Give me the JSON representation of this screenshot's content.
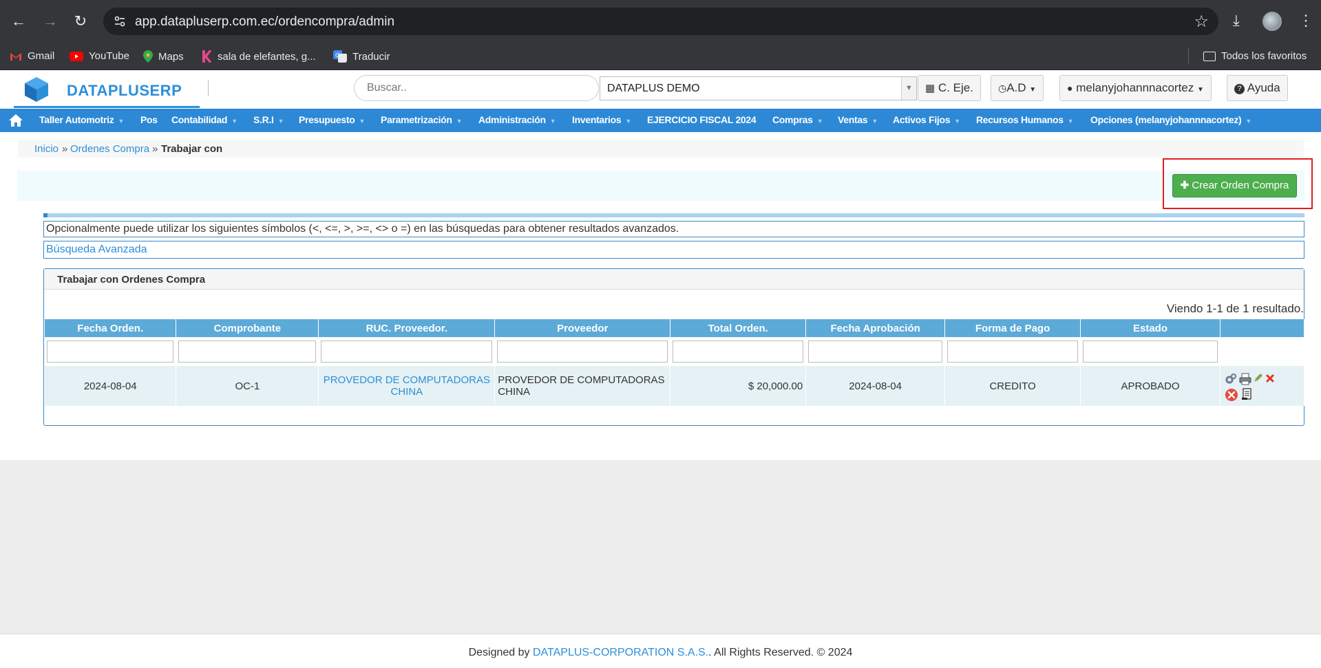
{
  "browser": {
    "url": "app.datapluserp.com.ec/ordencompra/admin",
    "bookmarks": [
      {
        "label": "Gmail"
      },
      {
        "label": "YouTube"
      },
      {
        "label": "Maps"
      },
      {
        "label": "sala de elefantes, g..."
      },
      {
        "label": "Traducir"
      }
    ],
    "all_bookmarks": "Todos los favoritos"
  },
  "header": {
    "logo_text": "DATAPLUSERP",
    "search_placeholder": "Buscar..",
    "company": "DATAPLUS DEMO",
    "btn_exercise": "C. Eje.",
    "btn_ad": "A.D",
    "btn_user": "melanyjohannnacortez",
    "btn_help": "Ayuda"
  },
  "menu": [
    "Taller Automotriz",
    "Pos",
    "Contabilidad",
    "S.R.I",
    "Presupuesto",
    "Parametrización",
    "Administración",
    "Inventarios",
    "EJERCICIO FISCAL 2024",
    "Compras",
    "Ventas",
    "Activos Fijos",
    "Recursos Humanos",
    "Opciones (melanyjohannnacortez)"
  ],
  "breadcrumb": {
    "home": "Inicio",
    "section": "Ordenes Compra",
    "current": "Trabajar con",
    "sep": "»"
  },
  "create_button": "Crear Orden Compra",
  "info_text": "Opcionalmente puede utilizar los siguientes símbolos (<, <=, >, >=, <> o =) en las búsquedas para obtener resultados avanzados.",
  "advanced_search": "Búsqueda Avanzada",
  "panel": {
    "title": "Trabajar con Ordenes Compra",
    "summary": "Viendo 1-1 de 1 resultado."
  },
  "table": {
    "columns": [
      "Fecha Orden.",
      "Comprobante",
      "RUC. Proveedor.",
      "Proveedor",
      "Total Orden.",
      "Fecha Aprobación",
      "Forma de Pago",
      "Estado",
      ""
    ],
    "rows": [
      {
        "fecha_orden": "2024-08-04",
        "comprobante": "OC-1",
        "ruc_proveedor": "PROVEDOR DE COMPUTADORAS CHINA",
        "proveedor": "PROVEDOR DE COMPUTADORAS CHINA",
        "total": "$ 20,000.00",
        "fecha_aprobacion": "2024-08-04",
        "forma_pago": "CREDITO",
        "estado": "APROBADO"
      }
    ]
  },
  "footer": {
    "prefix": "Designed by",
    "link": "DATAPLUS-CORPORATION S.A.S.",
    "suffix": ". All Rights Reserved. © 2024"
  },
  "colors": {
    "brand_blue": "#2d89d6",
    "create_green": "#4cae4c",
    "highlight_red": "#e31b23"
  }
}
